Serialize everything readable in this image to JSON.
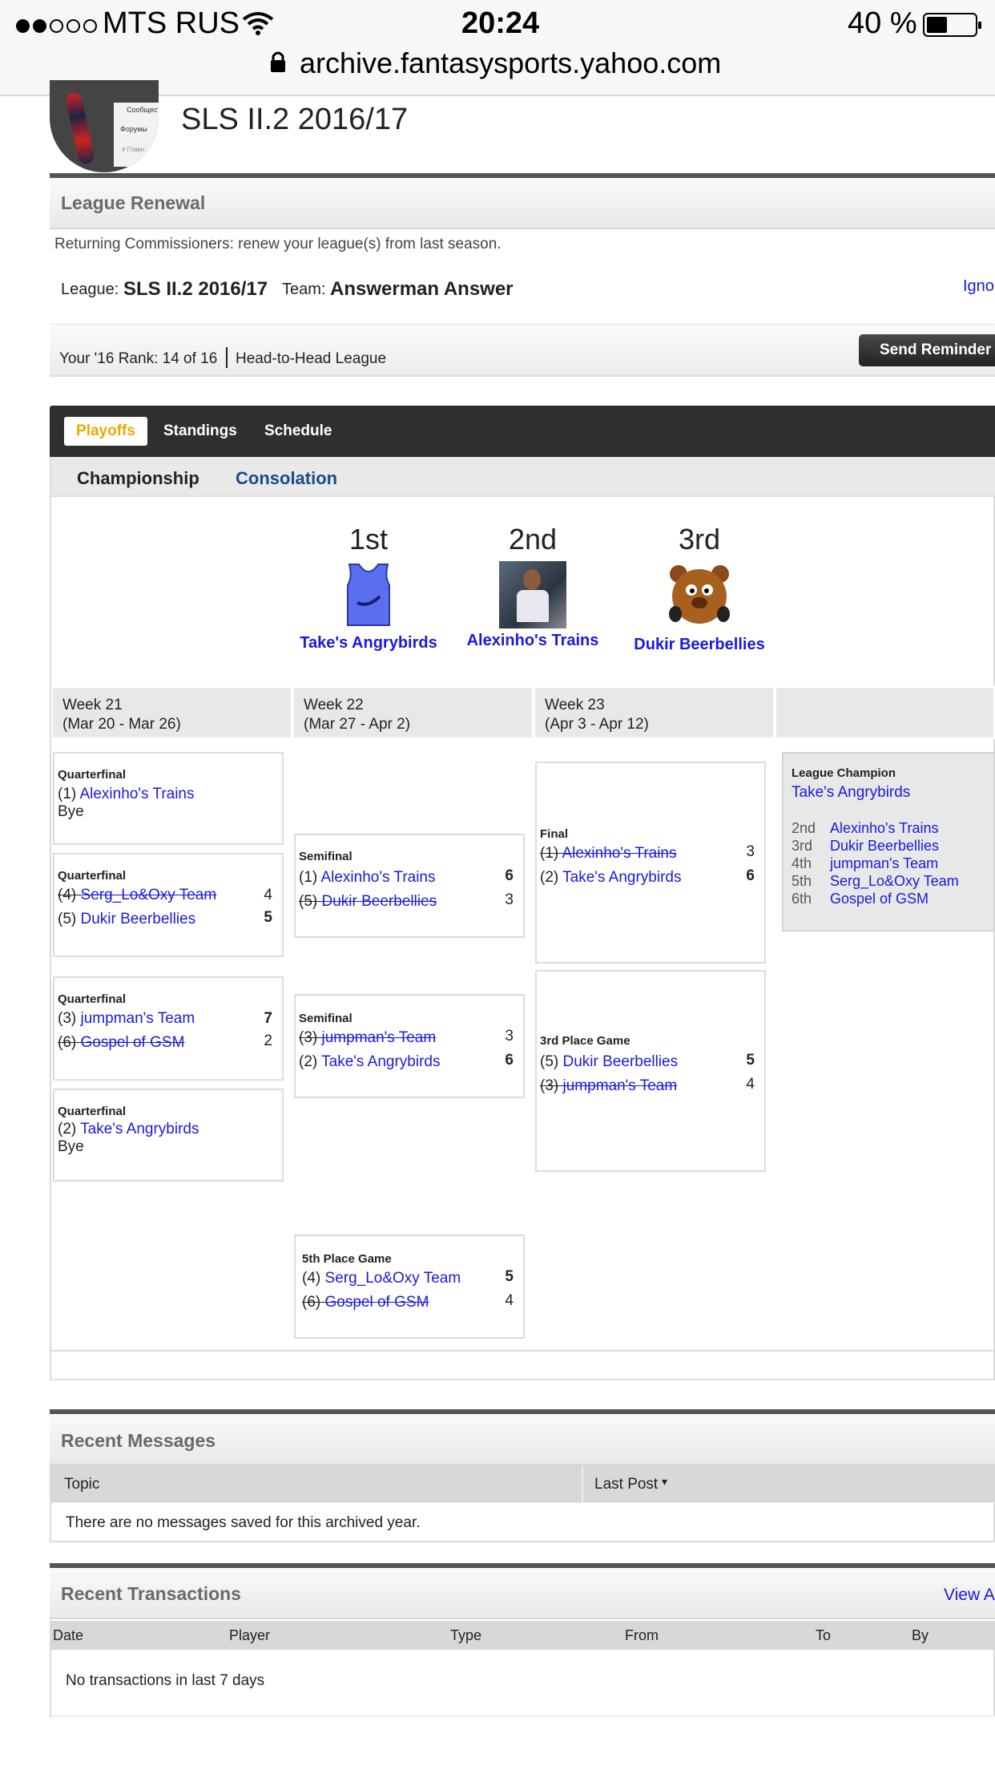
{
  "status_bar": {
    "carrier": "MTS RUS",
    "time": "20:24",
    "battery": "40 %",
    "url": "archive.fantasysports.yahoo.com"
  },
  "league": {
    "name": "SLS II.2 2016/17",
    "logo_menu": [
      "Сообщест",
      "Форумы",
      "# Главн"
    ]
  },
  "renewal": {
    "title": "League Renewal",
    "description": "Returning Commissioners: renew your league(s) from last season.",
    "league_label": "League:",
    "league_value": "SLS II.2 2016/17",
    "team_label": "Team:",
    "team_value": "Answerman Answer",
    "ignore_link": "Ignor",
    "rank_text": "Your '16 Rank: 14 of 16",
    "league_type": "Head-to-Head League",
    "reminder_button": "Send Reminder"
  },
  "tabs": {
    "items": [
      "Playoffs",
      "Standings",
      "Schedule"
    ],
    "active": "Playoffs",
    "sub_items": [
      "Championship",
      "Consolation"
    ]
  },
  "podium": [
    {
      "place": "1st",
      "team": "Take's Angrybirds",
      "icon": "jersey-icon"
    },
    {
      "place": "2nd",
      "team": "Alexinho's Trains",
      "icon": "player-photo"
    },
    {
      "place": "3rd",
      "team": "Dukir Beerbellies",
      "icon": "bear-avatar"
    }
  ],
  "weeks": [
    {
      "label": "Week 21",
      "range": "(Mar 20 - Mar 26)"
    },
    {
      "label": "Week 22",
      "range": "(Mar 27 - Apr 2)"
    },
    {
      "label": "Week 23",
      "range": "(Apr 3 - Apr 12)"
    }
  ],
  "bracket": {
    "qf1": {
      "title": "Quarterfinal",
      "t1_seed": "(1)",
      "t1": "Alexinho's Trains",
      "bye": "Bye"
    },
    "qf2": {
      "title": "Quarterfinal",
      "t1_seed": "(4)",
      "t1": "Serg_Lo&Oxy Team",
      "s1": "4",
      "t2_seed": "(5)",
      "t2": "Dukir Beerbellies",
      "s2": "5"
    },
    "qf3": {
      "title": "Quarterfinal",
      "t1_seed": "(3)",
      "t1": "jumpman's Team",
      "s1": "7",
      "t2_seed": "(6)",
      "t2": "Gospel of GSM",
      "s2": "2"
    },
    "qf4": {
      "title": "Quarterfinal",
      "t1_seed": "(2)",
      "t1": "Take's Angrybirds",
      "bye": "Bye"
    },
    "sf1": {
      "title": "Semifinal",
      "t1_seed": "(1)",
      "t1": "Alexinho's Trains",
      "s1": "6",
      "t2_seed": "(5)",
      "t2": "Dukir Beerbellies",
      "s2": "3"
    },
    "sf2": {
      "title": "Semifinal",
      "t1_seed": "(3)",
      "t1": "jumpman's Team",
      "s1": "3",
      "t2_seed": "(2)",
      "t2": "Take's Angrybirds",
      "s2": "6"
    },
    "fifth": {
      "title": "5th Place Game",
      "t1_seed": "(4)",
      "t1": "Serg_Lo&Oxy Team",
      "s1": "5",
      "t2_seed": "(6)",
      "t2": "Gospel of GSM",
      "s2": "4"
    },
    "final": {
      "title": "Final",
      "t1_seed": "(1)",
      "t1": "Alexinho's Trains",
      "s1": "3",
      "t2_seed": "(2)",
      "t2": "Take's Angrybirds",
      "s2": "6"
    },
    "third": {
      "title": "3rd Place Game",
      "t1_seed": "(5)",
      "t1": "Dukir Beerbellies",
      "s1": "5",
      "t2_seed": "(3)",
      "t2": "jumpman's Team",
      "s2": "4"
    }
  },
  "champion": {
    "title": "League Champion",
    "team": "Take's Angrybirds",
    "places": [
      {
        "place": "2nd",
        "team": "Alexinho's Trains"
      },
      {
        "place": "3rd",
        "team": "Dukir Beerbellies"
      },
      {
        "place": "4th",
        "team": "jumpman's Team"
      },
      {
        "place": "5th",
        "team": "Serg_Lo&Oxy Team"
      },
      {
        "place": "6th",
        "team": "Gospel of GSM"
      }
    ]
  },
  "messages": {
    "title": "Recent Messages",
    "col_topic": "Topic",
    "col_last": "Last Post",
    "empty": "There are no messages saved for this archived year."
  },
  "transactions": {
    "title": "Recent Transactions",
    "view_link": "View A",
    "columns": [
      "Date",
      "Player",
      "Type",
      "From",
      "To",
      "By"
    ],
    "empty": "No transactions in last 7 days"
  },
  "colors": {
    "link": "#1a1adc",
    "tab_active": "#f0a800",
    "tabbar": "#333333"
  }
}
